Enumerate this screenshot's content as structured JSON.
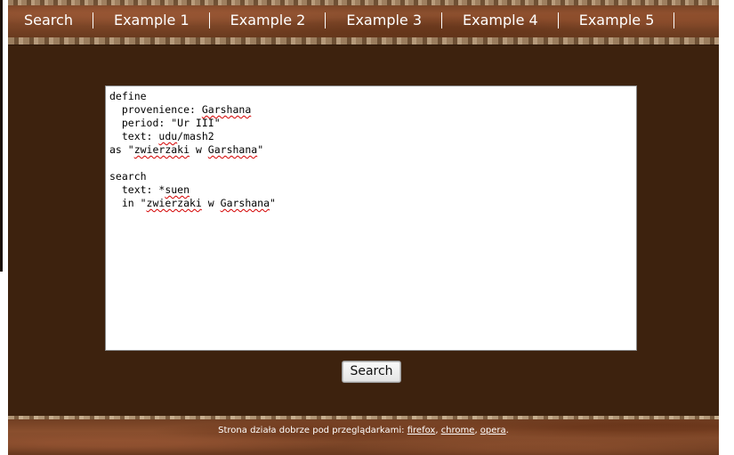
{
  "nav": {
    "items": [
      {
        "label": "Search"
      },
      {
        "label": "Example 1"
      },
      {
        "label": "Example 2"
      },
      {
        "label": "Example 3"
      },
      {
        "label": "Example 4"
      },
      {
        "label": "Example 5"
      }
    ]
  },
  "editor": {
    "lines": {
      "l1": "define",
      "l2a": "  provenience: ",
      "l2b": "Garshana",
      "l3": "  period: \"Ur III\"",
      "l4a": "  text: ",
      "l4b": "udu",
      "l4c": "/mash2",
      "l5a": "as \"",
      "l5b": "zwierzaki",
      "l5c": " w ",
      "l5d": "Garshana",
      "l5e": "\"",
      "l6": "",
      "l7": "search",
      "l8a": "  text: *",
      "l8b": "suen",
      "l9a": "  in \"",
      "l9b": "zwierzaki",
      "l9c": " w ",
      "l9d": "Garshana",
      "l9e": "\""
    }
  },
  "search_button": {
    "label": "Search"
  },
  "footer": {
    "prefix": "Strona działa dobrze pod przeglądarkami: ",
    "link_firefox": "firefox",
    "sep1": ", ",
    "link_chrome": "chrome",
    "sep2": ", ",
    "link_opera": "opera",
    "suffix": "."
  },
  "colors": {
    "background": "#3d220e",
    "nav_text": "#ffffff",
    "spellcheck_underline": "#d40000"
  }
}
